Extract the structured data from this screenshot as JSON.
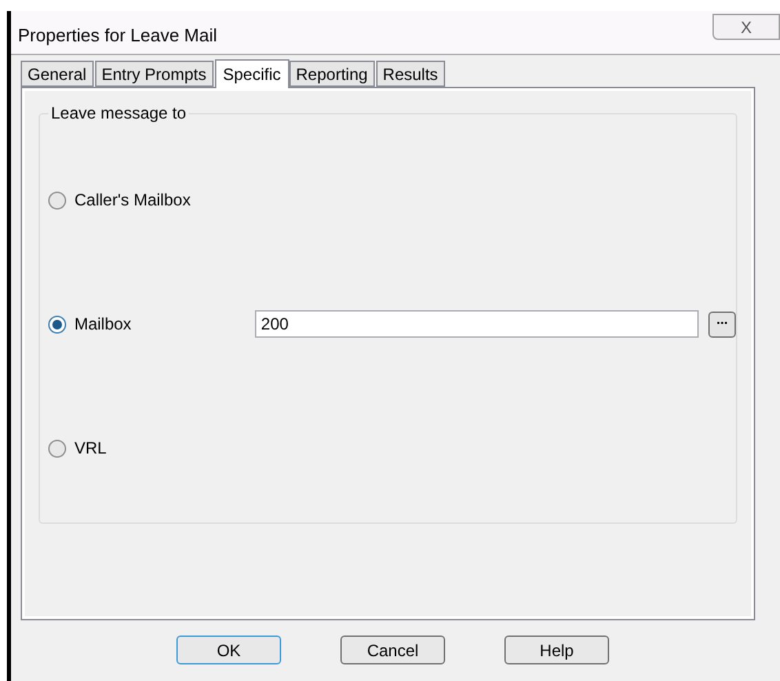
{
  "window": {
    "title": "Properties for Leave Mail",
    "close": "X"
  },
  "tabs": [
    {
      "label": "General",
      "selected": false
    },
    {
      "label": "Entry Prompts",
      "selected": false
    },
    {
      "label": "Specific",
      "selected": true
    },
    {
      "label": "Reporting",
      "selected": false
    },
    {
      "label": "Results",
      "selected": false
    }
  ],
  "group": {
    "title": "Leave message to",
    "options": [
      {
        "label": "Caller's Mailbox",
        "selected": false
      },
      {
        "label": "Mailbox",
        "selected": true,
        "value": "200",
        "browse": "..."
      },
      {
        "label": "VRL",
        "selected": false
      }
    ]
  },
  "buttons": [
    {
      "label": "OK",
      "default": true
    },
    {
      "label": "Cancel",
      "default": false
    },
    {
      "label": "Help",
      "default": false
    }
  ]
}
